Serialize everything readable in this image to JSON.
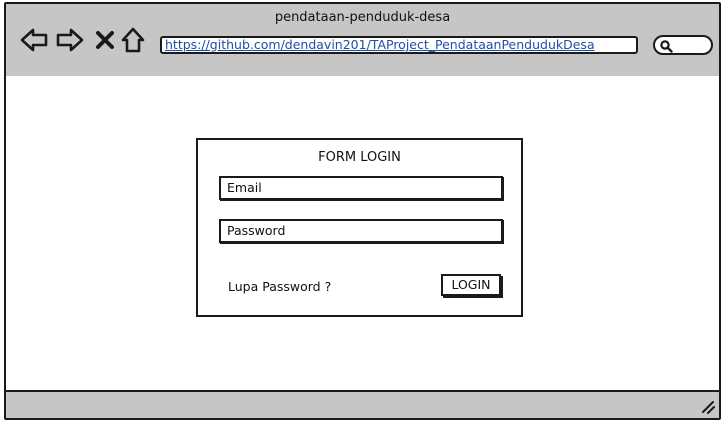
{
  "window": {
    "title": "pendataan-penduduk-desa"
  },
  "toolbar": {
    "url": "https://github.com/dendavin201/TAProject_PendataanPendudukDesa",
    "icons": [
      "back-arrow-icon",
      "forward-arrow-icon",
      "close-x-icon",
      "home-icon",
      "search-icon"
    ]
  },
  "login_form": {
    "title": "FORM LOGIN",
    "email_placeholder": "Email",
    "password_placeholder": "Password",
    "forgot_label": "Lupa Password ?",
    "login_label": "LOGIN"
  },
  "colors": {
    "chrome": "#c6c6c6",
    "border": "#1a1a1a",
    "link": "#1f4fa8"
  }
}
